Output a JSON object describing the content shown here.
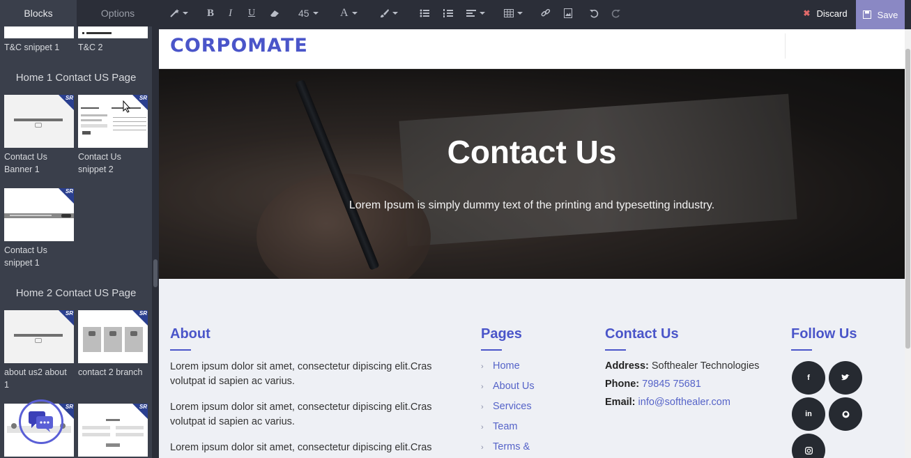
{
  "tabs": {
    "blocks": "Blocks",
    "options": "Options"
  },
  "toolbar": {
    "font_size": "45",
    "discard_label": "Discard",
    "save_label": "Save"
  },
  "sidebar": {
    "tc_items": [
      {
        "label": "T&C snippet 1"
      },
      {
        "label": "T&C 2"
      }
    ],
    "home1_heading": "Home 1 Contact US Page",
    "home1_items": [
      {
        "label": "Contact Us Banner 1"
      },
      {
        "label": "Contact Us snippet 2"
      },
      {
        "label": "Contact Us snippet 1"
      }
    ],
    "home2_heading": "Home 2 Contact US Page",
    "home2_items": [
      {
        "label": "about us2 about 1"
      },
      {
        "label": "contact 2 branch"
      }
    ],
    "badge_text": "SR"
  },
  "site": {
    "logo": "CORPOMATE",
    "hero_title": "Contact Us",
    "hero_subtitle": "Lorem Ipsum is simply dummy text of the printing and typesetting industry."
  },
  "footer": {
    "about": {
      "heading": "About",
      "paragraphs": [
        "Lorem ipsum dolor sit amet, consectetur dipiscing elit.Cras volutpat id sapien ac varius.",
        "Lorem ipsum dolor sit amet, consectetur dipiscing elit.Cras volutpat id sapien ac varius.",
        "Lorem ipsum dolor sit amet, consectetur dipiscing elit.Cras"
      ]
    },
    "pages": {
      "heading": "Pages",
      "links": [
        "Home",
        "About Us",
        "Services",
        "Team",
        "Terms &"
      ]
    },
    "contact": {
      "heading": "Contact Us",
      "address_label": "Address:",
      "address_value": "Softhealer Technologies",
      "phone_label": "Phone:",
      "phone_value": "79845 75681",
      "email_label": "Email:",
      "email_value": "info@softhealer.com"
    },
    "follow": {
      "heading": "Follow Us",
      "icons": [
        "facebook-icon",
        "twitter-icon",
        "linkedin-icon",
        "github-icon",
        "instagram-icon"
      ]
    }
  },
  "colors": {
    "accent": "#4a55c9",
    "save_bg": "#8a88c4",
    "sidebar_bg": "#3a3f4b",
    "topbar_bg": "#2b2e38"
  }
}
